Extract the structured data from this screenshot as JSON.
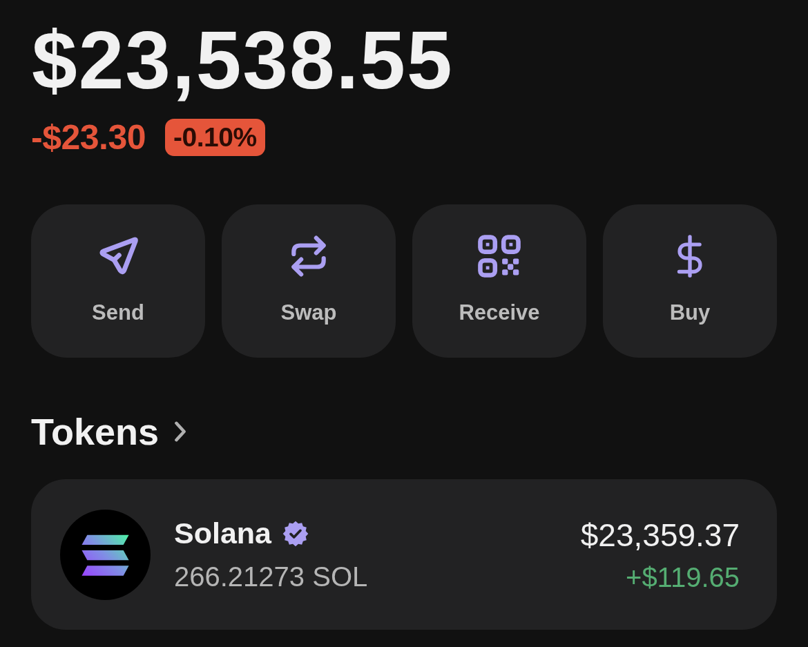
{
  "balance": {
    "total": "$23,538.55",
    "change_amount": "-$23.30",
    "change_percent": "-0.10%",
    "positive": false
  },
  "actions": [
    {
      "kind": "send",
      "label": "Send"
    },
    {
      "kind": "swap",
      "label": "Swap"
    },
    {
      "kind": "receive",
      "label": "Receive"
    },
    {
      "kind": "buy",
      "label": "Buy"
    }
  ],
  "tokens": {
    "title": "Tokens",
    "items": [
      {
        "name": "Solana",
        "verified": true,
        "amount": "266.21273 SOL",
        "value": "$23,359.37",
        "change": "+$119.65",
        "positive": true
      }
    ]
  }
}
